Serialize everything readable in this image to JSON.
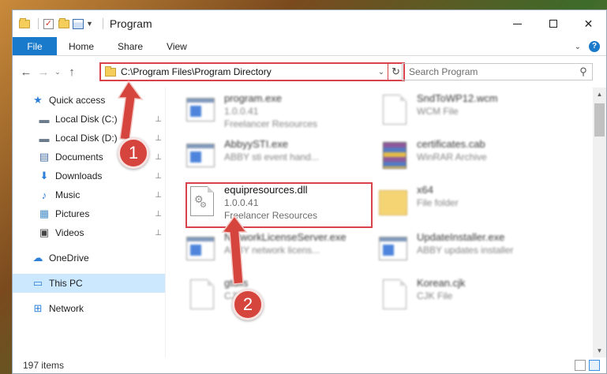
{
  "window": {
    "title": "Program",
    "minimize_glyph": "",
    "maximize_glyph": "",
    "close_glyph": "✕"
  },
  "ribbon": {
    "file": "File",
    "tabs": [
      "Home",
      "Share",
      "View"
    ],
    "help_glyph": "?",
    "expand_glyph": "⌄"
  },
  "navbar": {
    "back_glyph": "←",
    "forward_glyph": "→",
    "recent_glyph": "⌄",
    "up_glyph": "↑",
    "address": "C:\\Program Files\\Program Directory",
    "chevron_glyph": "⌄",
    "refresh_glyph": "↻",
    "search_placeholder": "Search Program",
    "search_glyph": "⚲"
  },
  "sidebar": {
    "items": [
      {
        "label": "Quick access",
        "icon": "star-icon",
        "glyph": "★",
        "color": "#2d7fd8"
      },
      {
        "label": "Local Disk (C:)",
        "icon": "drive-icon",
        "glyph": "▬",
        "color": "#6b7b8c",
        "pin": "📌"
      },
      {
        "label": "Local Disk (D:)",
        "icon": "drive-icon",
        "glyph": "▬",
        "color": "#6b7b8c",
        "pin": "📌"
      },
      {
        "label": "Documents",
        "icon": "documents-icon",
        "glyph": "▤",
        "color": "#4a6fa5",
        "pin": "📌"
      },
      {
        "label": "Downloads",
        "icon": "download-icon",
        "glyph": "⬇",
        "color": "#2d7fd8",
        "pin": "📌"
      },
      {
        "label": "Music",
        "icon": "music-icon",
        "glyph": "♪",
        "color": "#2d7fd8",
        "pin": "📌"
      },
      {
        "label": "Pictures",
        "icon": "pictures-icon",
        "glyph": "▦",
        "color": "#4a8fc8",
        "pin": "📌"
      },
      {
        "label": "Videos",
        "icon": "videos-icon",
        "glyph": "▣",
        "color": "#444444",
        "pin": "📌"
      },
      {
        "label": "OneDrive",
        "icon": "cloud-icon",
        "glyph": "☁",
        "color": "#2d7fd8"
      },
      {
        "label": "This PC",
        "icon": "computer-icon",
        "glyph": "▭",
        "color": "#2d7fd8"
      },
      {
        "label": "Network",
        "icon": "network-icon",
        "glyph": "⊞",
        "color": "#2d7fd8"
      }
    ]
  },
  "files": [
    {
      "name": "program.exe",
      "line2": "1.0.0.41",
      "line3": "Freelancer Resources",
      "icon": "exe-icon"
    },
    {
      "name": "SndToWP12.wcm",
      "line2": "WCM File",
      "line3": "",
      "icon": "file-icon"
    },
    {
      "name": "AbbyySTI.exe",
      "line2": "ABBY sti event hand...",
      "line3": "",
      "icon": "exe-icon"
    },
    {
      "name": "certificates.cab",
      "line2": "WinRAR Archive",
      "line3": "",
      "icon": "archive-icon"
    },
    {
      "name": "equipresources.dll",
      "line2": "1.0.0.41",
      "line3": "Freelancer Resources",
      "icon": "dll-icon"
    },
    {
      "name": "x64",
      "line2": "File folder",
      "line3": "",
      "icon": "folder-icon"
    },
    {
      "name": "NetworkLicenseServer.exe",
      "line2": "ABBY network licens...",
      "line3": "",
      "icon": "exe-icon"
    },
    {
      "name": "UpdateInstaller.exe",
      "line2": "ABBY updates installer",
      "line3": "",
      "icon": "exe-icon"
    },
    {
      "name": "gtdlls",
      "line2": "CJK File",
      "line3": "",
      "icon": "file-icon"
    },
    {
      "name": "Korean.cjk",
      "line2": "CJK File",
      "line3": "",
      "icon": "file-icon"
    }
  ],
  "status": {
    "count": "197 items"
  },
  "annotations": {
    "step1": "1",
    "step2": "2"
  },
  "colors": {
    "accent": "#1979ca",
    "highlight": "#d9414b",
    "selection": "#cce8ff"
  }
}
